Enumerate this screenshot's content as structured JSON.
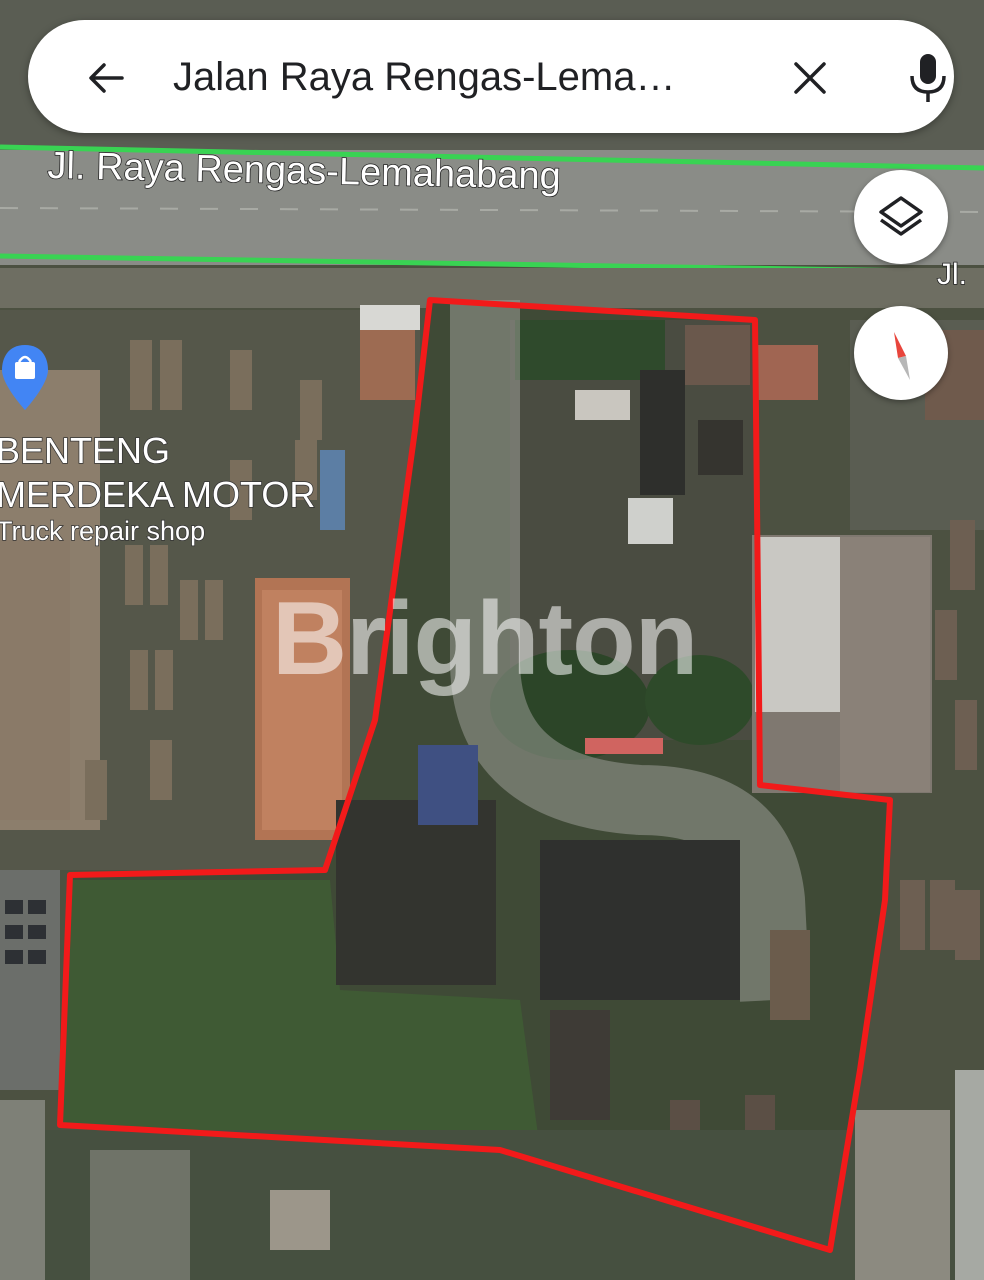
{
  "search": {
    "query": "Jalan Raya Rengas-Lema…"
  },
  "map": {
    "road_label_main": "Jl. Raya Rengas-Lemahabang",
    "road_label_edge": "Jl.",
    "poi": {
      "name_line1": "BENTENG",
      "name_line2": "MERDEKA MOTOR",
      "category": "Truck repair shop",
      "icon": "shopping-bag-pin-icon"
    },
    "watermark": "Brighton"
  },
  "controls": {
    "back_icon": "arrow-back-icon",
    "clear_icon": "close-icon",
    "mic_icon": "microphone-icon",
    "layers_icon": "layers-icon",
    "compass_icon": "compass-icon"
  },
  "colors": {
    "boundary": "#f21a1a",
    "road_highlight": "#39d353",
    "poi_pin": "#4285f4"
  }
}
